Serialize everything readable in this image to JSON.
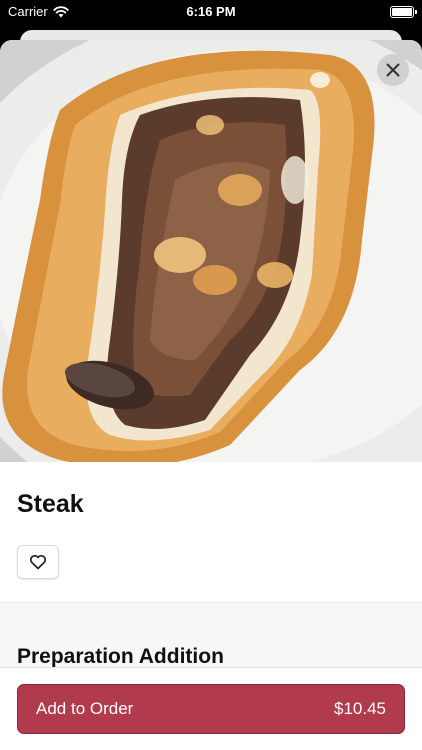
{
  "status_bar": {
    "carrier": "Carrier",
    "time": "6:16 PM",
    "wifi_icon": "wifi-icon",
    "battery_icon": "battery-icon"
  },
  "item": {
    "photo_icon": "food-photo",
    "title": "Steak",
    "favorite_icon": "heart-icon",
    "close_icon": "close-icon"
  },
  "section": {
    "title": "Preparation Addition"
  },
  "order": {
    "button_label": "Add to Order",
    "price": "$10.45"
  },
  "colors": {
    "accent": "#b23a4d"
  }
}
